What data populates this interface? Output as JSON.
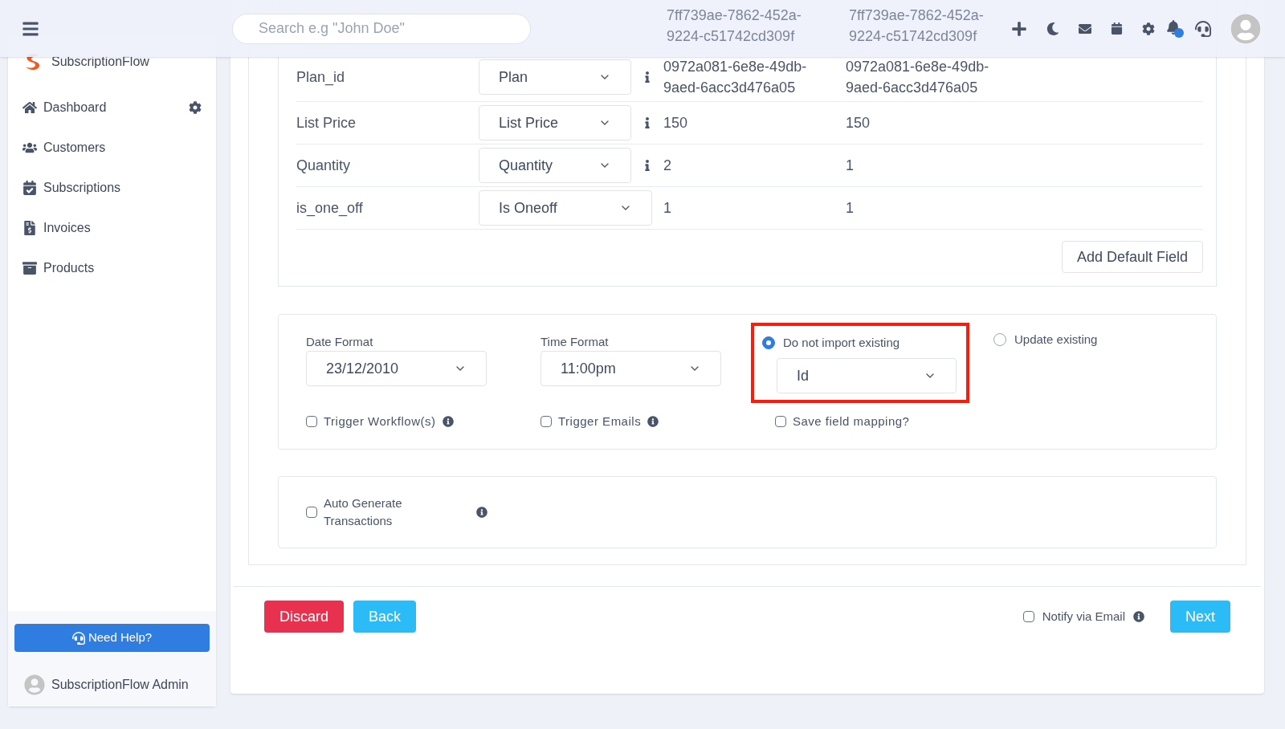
{
  "header": {
    "search_placeholder": "Search e.g \"John Doe\""
  },
  "sidebar": {
    "brand": "SubscriptionFlow",
    "items": [
      {
        "label": "Dashboard",
        "selected": false,
        "settings": true
      },
      {
        "label": "Customers",
        "selected": false,
        "settings": false
      },
      {
        "label": "Subscriptions",
        "selected": false,
        "settings": false
      },
      {
        "label": "Invoices",
        "selected": false,
        "settings": false
      },
      {
        "label": "Products",
        "selected": false,
        "settings": false
      }
    ],
    "help_button": "Need Help?",
    "user": "SubscriptionFlow Admin"
  },
  "partial_row": {
    "value_1": "7ff739ae-7862-452a-9224-c51742cd309f",
    "value_2": "7ff739ae-7862-452a-9224-c51742cd309f"
  },
  "mapping_rows": [
    {
      "field": "Plan_id",
      "mapped_to": "Plan",
      "info": true,
      "value_1": "0972a081-6e8e-49db-9aed-6acc3d476a05",
      "value_2": "0972a081-6e8e-49db-9aed-6acc3d476a05"
    },
    {
      "field": "List Price",
      "mapped_to": "List Price",
      "info": true,
      "value_1": "150",
      "value_2": "150"
    },
    {
      "field": "Quantity",
      "mapped_to": "Quantity",
      "info": true,
      "value_1": "2",
      "value_2": "1"
    },
    {
      "field": "is_one_off",
      "mapped_to": "Is Oneoff",
      "info": false,
      "value_1": "1",
      "value_2": "1"
    }
  ],
  "add_default_field": "Add Default Field",
  "options": {
    "date_format": {
      "label": "Date Format",
      "value": "23/12/2010"
    },
    "time_format": {
      "label": "Time Format",
      "value": "11:00pm"
    },
    "existing": [
      {
        "label": "Do not import existing",
        "selected": true
      },
      {
        "label": "Update existing",
        "selected": false
      }
    ],
    "existing_key": "Id",
    "checkboxes": [
      {
        "label": "Trigger Workflow(s)",
        "checked": false,
        "info": true
      },
      {
        "label": "Trigger Emails",
        "checked": false,
        "info": true
      },
      {
        "label": "Save field mapping?",
        "checked": false,
        "info": false
      }
    ]
  },
  "auto_generate": {
    "label": "Auto Generate Transactions",
    "checked": false
  },
  "footer": {
    "discard": "Discard",
    "back": "Back",
    "notify": {
      "label": "Notify via Email",
      "checked": false
    },
    "next": "Next"
  }
}
